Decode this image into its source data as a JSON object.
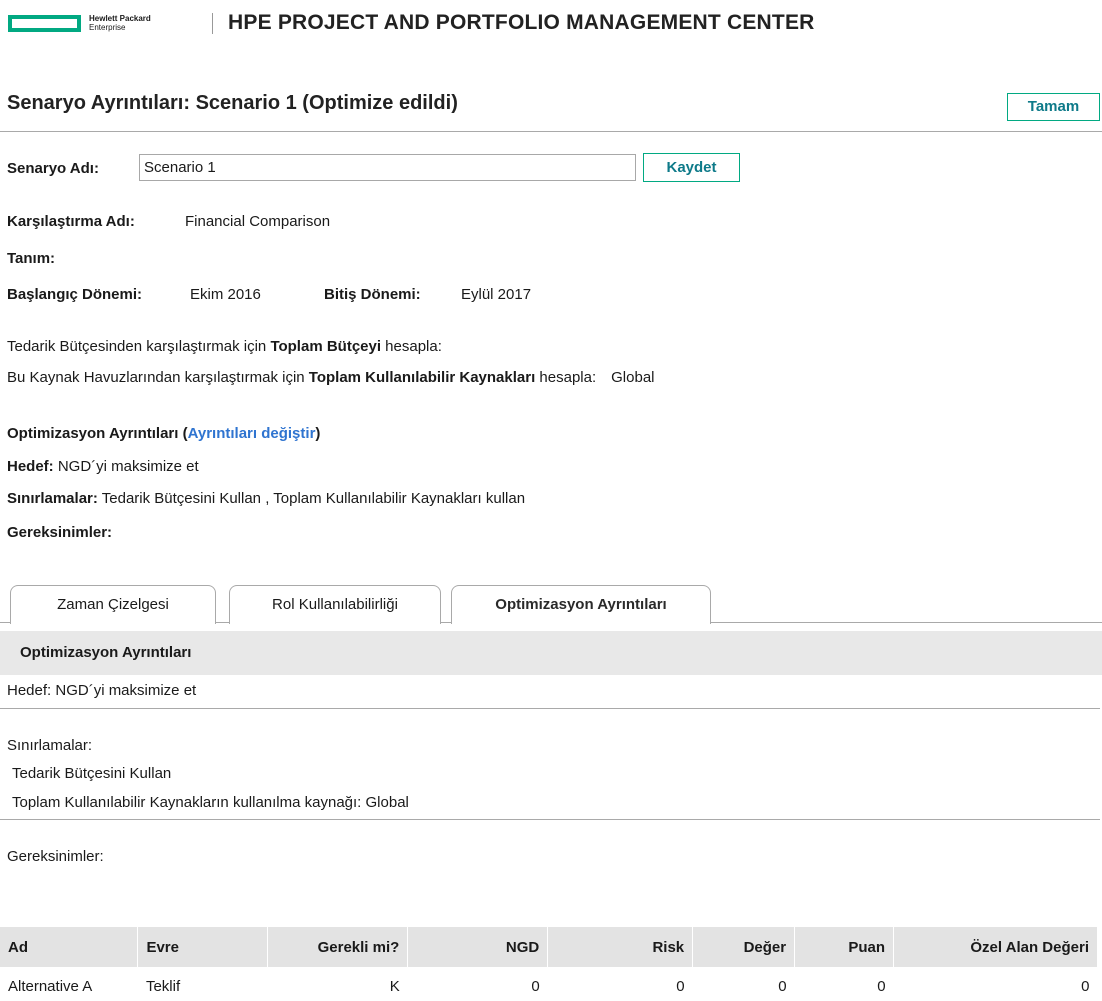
{
  "header": {
    "logo_line1": "Hewlett Packard",
    "logo_line2": "Enterprise",
    "app_title": "HPE PROJECT AND PORTFOLIO MANAGEMENT CENTER"
  },
  "page": {
    "title": "Senaryo Ayrıntıları: Scenario 1 (Optimize edildi)",
    "ok_button": "Tamam"
  },
  "scenario": {
    "name_label": "Senaryo Adı:",
    "name_value": "Scenario 1",
    "save_button": "Kaydet",
    "comparison_label": "Karşılaştırma Adı:",
    "comparison_value": "Financial Comparison",
    "description_label": "Tanım:",
    "start_label": "Başlangıç Dönemi:",
    "start_value": "Ekim 2016",
    "end_label": "Bitiş Dönemi:",
    "end_value": "Eylül 2017"
  },
  "budget": {
    "line1_prefix": "Tedarik Bütçesinden karşılaştırmak için ",
    "line1_bold": "Toplam Bütçeyi",
    "line1_suffix": " hesapla:",
    "line2_prefix": "Bu Kaynak Havuzlarından karşılaştırmak için ",
    "line2_bold": "Toplam Kullanılabilir Kaynakları",
    "line2_suffix": " hesapla:",
    "line2_value": "Global"
  },
  "optimization": {
    "title": "Optimizasyon Ayrıntıları (",
    "change_link": "Ayrıntıları değiştir",
    "title_close": ")",
    "goal_label": "Hedef:",
    "goal_value": " NGD´yi maksimize et",
    "constraints_label": "Sınırlamalar:",
    "constraints_value": " Tedarik Bütçesini Kullan , Toplam Kullanılabilir Kaynakları kullan",
    "requirements_label": "Gereksinimler:"
  },
  "tabs": [
    {
      "label": "Zaman Çizelgesi"
    },
    {
      "label": "Rol Kullanılabilirliği"
    },
    {
      "label": "Optimizasyon Ayrıntıları"
    }
  ],
  "details": {
    "section_title": "Optimizasyon Ayrıntıları",
    "goal_line": "Hedef:  NGD´yi maksimize et",
    "constraints_title": "Sınırlamalar:",
    "constraint_1": "Tedarik Bütçesini Kullan",
    "constraint_2": "Toplam Kullanılabilir Kaynakların kullanılma kaynağı: Global",
    "requirements_title": "Gereksinimler:"
  },
  "table": {
    "columns": [
      "Ad",
      "Evre",
      "Gerekli mi?",
      "NGD",
      "Risk",
      "Değer",
      "Puan",
      "Özel Alan Değeri"
    ],
    "rows": [
      [
        "Alternative A",
        "Teklif",
        "K",
        "0",
        "0",
        "0",
        "0",
        "0"
      ]
    ]
  }
}
